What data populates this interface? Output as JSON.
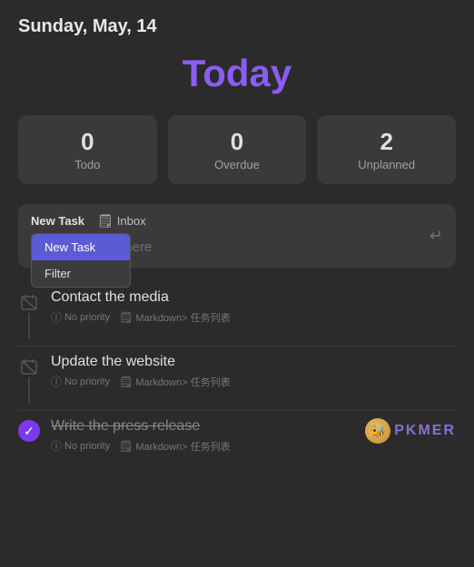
{
  "header": {
    "date": "Sunday, May, 14"
  },
  "today": {
    "title": "Today"
  },
  "stats": {
    "todo": {
      "number": "0",
      "label": "Todo"
    },
    "overdue": {
      "number": "0",
      "label": "Overdue"
    },
    "unplanned": {
      "number": "2",
      "label": "Unplanned"
    }
  },
  "task_input": {
    "tab_new_task": "New Task",
    "tab_inbox_icon": "🗒",
    "tab_inbox": "Inbox",
    "placeholder": "Add your tasks here",
    "dropdown": {
      "item1": "New Task",
      "item2": "Filter"
    }
  },
  "tasks": [
    {
      "id": 1,
      "title": "Contact the media",
      "completed": false,
      "priority": "No priority",
      "source": "Markdown",
      "path": "任务列表"
    },
    {
      "id": 2,
      "title": "Update the website",
      "completed": false,
      "priority": "No priority",
      "source": "Markdown",
      "path": "任务列表"
    },
    {
      "id": 3,
      "title": "Write the press release",
      "completed": true,
      "priority": "No priority",
      "source": "Markdown",
      "path": "任务列表"
    }
  ],
  "watermark": {
    "text": "PKMER"
  },
  "icons": {
    "info": "ⓘ",
    "file": "🗒",
    "check": "✓",
    "enter": "↵",
    "calendar_off": "📅"
  }
}
